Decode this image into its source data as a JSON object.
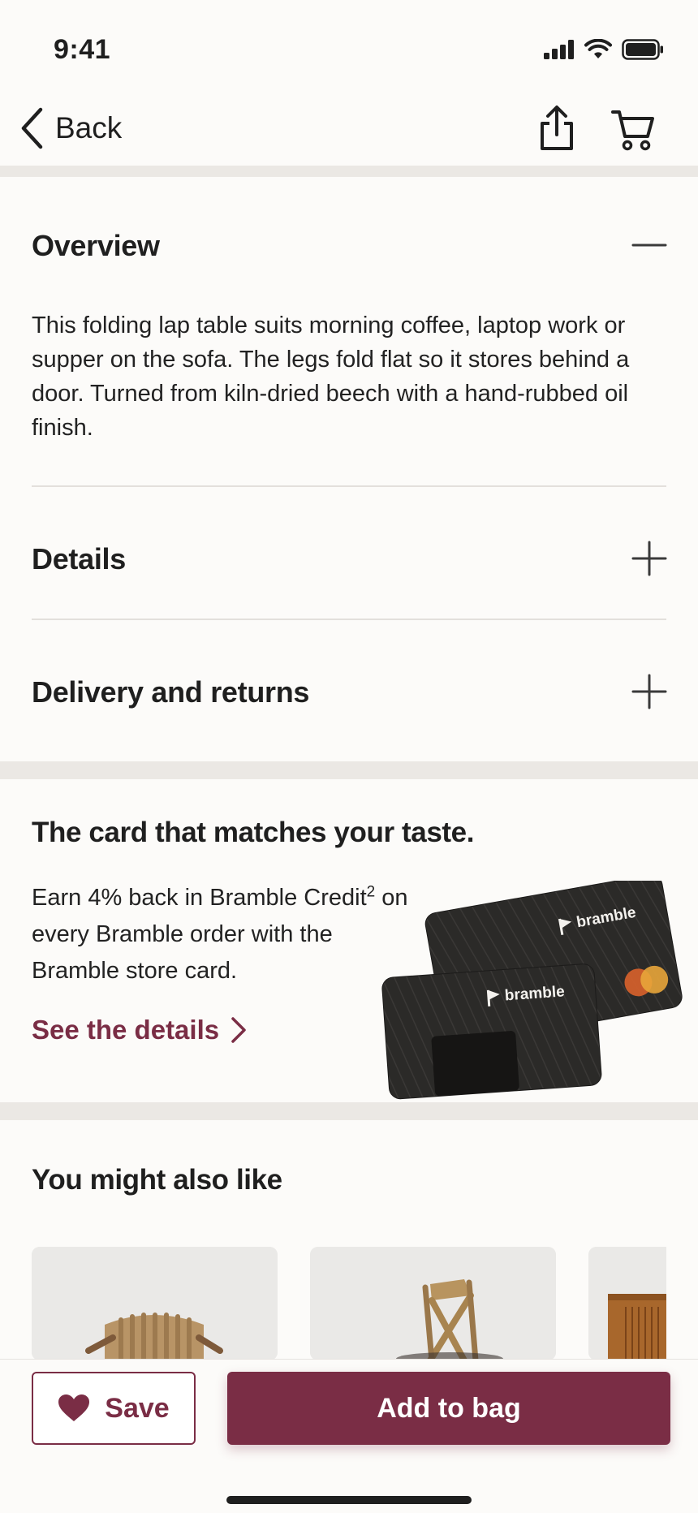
{
  "status_bar": {
    "time": "9:41"
  },
  "nav": {
    "back_label": "Back"
  },
  "accordion": {
    "overview": {
      "title": "Overview",
      "body": "This folding lap table suits morning coffee, laptop work or supper on the sofa. The legs fold flat so it stores behind a door. Turned from kiln-dried beech with a hand-rubbed oil finish."
    },
    "details": {
      "title": "Details"
    },
    "delivery": {
      "title": "Delivery and returns"
    }
  },
  "promo": {
    "title": "The card that matches your taste.",
    "body_before": "Earn 4% back in Bramble Credit",
    "footnote": "2",
    "body_after": " on every Bramble order with the Bramble store card.",
    "link_label": "See the details",
    "card_brand": "bramble"
  },
  "recommendations": {
    "title": "You might also like",
    "items": [
      {
        "name": "armchair"
      },
      {
        "name": "cross-back chair"
      },
      {
        "name": "sideboard"
      }
    ]
  },
  "bottom_bar": {
    "save_label": "Save",
    "add_label": "Add to bag"
  },
  "colors": {
    "accent": "#7a2d45",
    "background": "#fcfbf9",
    "divider": "#ebe8e4"
  }
}
